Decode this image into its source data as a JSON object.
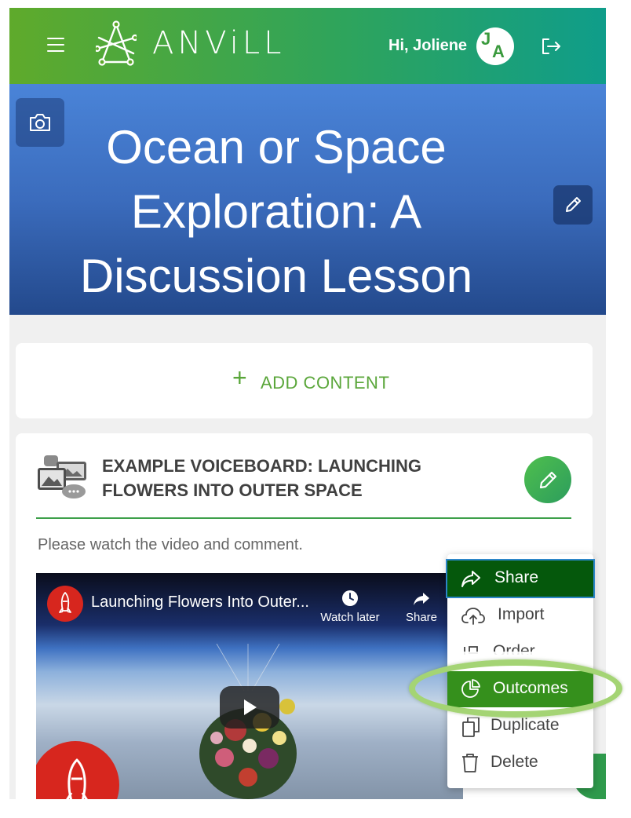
{
  "header": {
    "brand": "ANViLL",
    "greeting": "Hi, Joliene",
    "avatar_initials": [
      "J",
      "A"
    ]
  },
  "hero": {
    "title": "Ocean or Space Exploration: A Discussion Lesson"
  },
  "add_content": {
    "symbol": "+",
    "label": "ADD CONTENT"
  },
  "voiceboard": {
    "title_line1": "EXAMPLE VOICEBOARD: LAUNCHING",
    "title_line2": "FLOWERS INTO OUTER SPACE",
    "description": "Please watch the video and comment.",
    "video": {
      "title": "Launching Flowers Into Outer...",
      "watch_later": "Watch later",
      "share": "Share"
    }
  },
  "menu": {
    "items": [
      {
        "label": "Share",
        "icon": "share-arrow-icon",
        "active": true
      },
      {
        "label": "Import",
        "icon": "cloud-upload-icon"
      },
      {
        "label": "Order",
        "icon": "order-icon"
      },
      {
        "label": "Outcomes",
        "icon": "pie-chart-icon",
        "highlighted": true
      },
      {
        "label": "Duplicate",
        "icon": "copy-icon"
      },
      {
        "label": "Delete",
        "icon": "trash-icon"
      }
    ]
  },
  "colors": {
    "brand_green": "#5aa63a",
    "share_bg": "#05580c",
    "outcomes_bg": "#35901c",
    "highlight_ring": "#a4d474"
  }
}
